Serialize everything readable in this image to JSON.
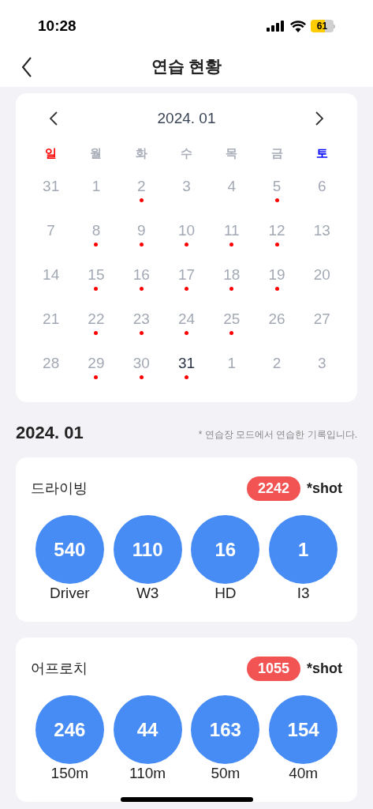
{
  "status_bar": {
    "time": "10:28",
    "battery": "61"
  },
  "header": {
    "title": "연습 현황"
  },
  "calendar": {
    "month": "2024. 01",
    "weekdays": [
      {
        "label": "일",
        "kind": "sunday"
      },
      {
        "label": "월",
        "kind": "weekday"
      },
      {
        "label": "화",
        "kind": "weekday"
      },
      {
        "label": "수",
        "kind": "weekday"
      },
      {
        "label": "목",
        "kind": "weekday"
      },
      {
        "label": "금",
        "kind": "weekday"
      },
      {
        "label": "토",
        "kind": "saturday"
      }
    ],
    "days": [
      {
        "label": "31",
        "selected": false,
        "practiced": false
      },
      {
        "label": "1",
        "selected": false,
        "practiced": false
      },
      {
        "label": "2",
        "selected": false,
        "practiced": true
      },
      {
        "label": "3",
        "selected": false,
        "practiced": false
      },
      {
        "label": "4",
        "selected": false,
        "practiced": false
      },
      {
        "label": "5",
        "selected": false,
        "practiced": true
      },
      {
        "label": "6",
        "selected": false,
        "practiced": false
      },
      {
        "label": "7",
        "selected": false,
        "practiced": false
      },
      {
        "label": "8",
        "selected": false,
        "practiced": true
      },
      {
        "label": "9",
        "selected": false,
        "practiced": true
      },
      {
        "label": "10",
        "selected": false,
        "practiced": true
      },
      {
        "label": "11",
        "selected": false,
        "practiced": true
      },
      {
        "label": "12",
        "selected": false,
        "practiced": true
      },
      {
        "label": "13",
        "selected": false,
        "practiced": false
      },
      {
        "label": "14",
        "selected": false,
        "practiced": false
      },
      {
        "label": "15",
        "selected": false,
        "practiced": true
      },
      {
        "label": "16",
        "selected": false,
        "practiced": true
      },
      {
        "label": "17",
        "selected": false,
        "practiced": true
      },
      {
        "label": "18",
        "selected": false,
        "practiced": true
      },
      {
        "label": "19",
        "selected": false,
        "practiced": true
      },
      {
        "label": "20",
        "selected": false,
        "practiced": false
      },
      {
        "label": "21",
        "selected": false,
        "practiced": false
      },
      {
        "label": "22",
        "selected": false,
        "practiced": true
      },
      {
        "label": "23",
        "selected": false,
        "practiced": true
      },
      {
        "label": "24",
        "selected": false,
        "practiced": true
      },
      {
        "label": "25",
        "selected": false,
        "practiced": true
      },
      {
        "label": "26",
        "selected": false,
        "practiced": false
      },
      {
        "label": "27",
        "selected": false,
        "practiced": false
      },
      {
        "label": "28",
        "selected": false,
        "practiced": false
      },
      {
        "label": "29",
        "selected": false,
        "practiced": true
      },
      {
        "label": "30",
        "selected": false,
        "practiced": true
      },
      {
        "label": "31",
        "selected": true,
        "practiced": true
      },
      {
        "label": "1",
        "selected": false,
        "practiced": false
      },
      {
        "label": "2",
        "selected": false,
        "practiced": false
      },
      {
        "label": "3",
        "selected": false,
        "practiced": false
      }
    ]
  },
  "summary": {
    "title": "2024. 01",
    "note": "* 연습장 모드에서 연습한 기록입니다."
  },
  "sections": [
    {
      "title": "드라이빙",
      "total": "2242",
      "unit": "*shot",
      "clubs": [
        {
          "count": "540",
          "label": "Driver"
        },
        {
          "count": "110",
          "label": "W3"
        },
        {
          "count": "16",
          "label": "HD"
        },
        {
          "count": "1",
          "label": "I3"
        }
      ]
    },
    {
      "title": "어프로치",
      "total": "1055",
      "unit": "*shot",
      "clubs": [
        {
          "count": "246",
          "label": "150m"
        },
        {
          "count": "44",
          "label": "110m"
        },
        {
          "count": "163",
          "label": "50m"
        },
        {
          "count": "154",
          "label": "40m"
        }
      ]
    }
  ]
}
